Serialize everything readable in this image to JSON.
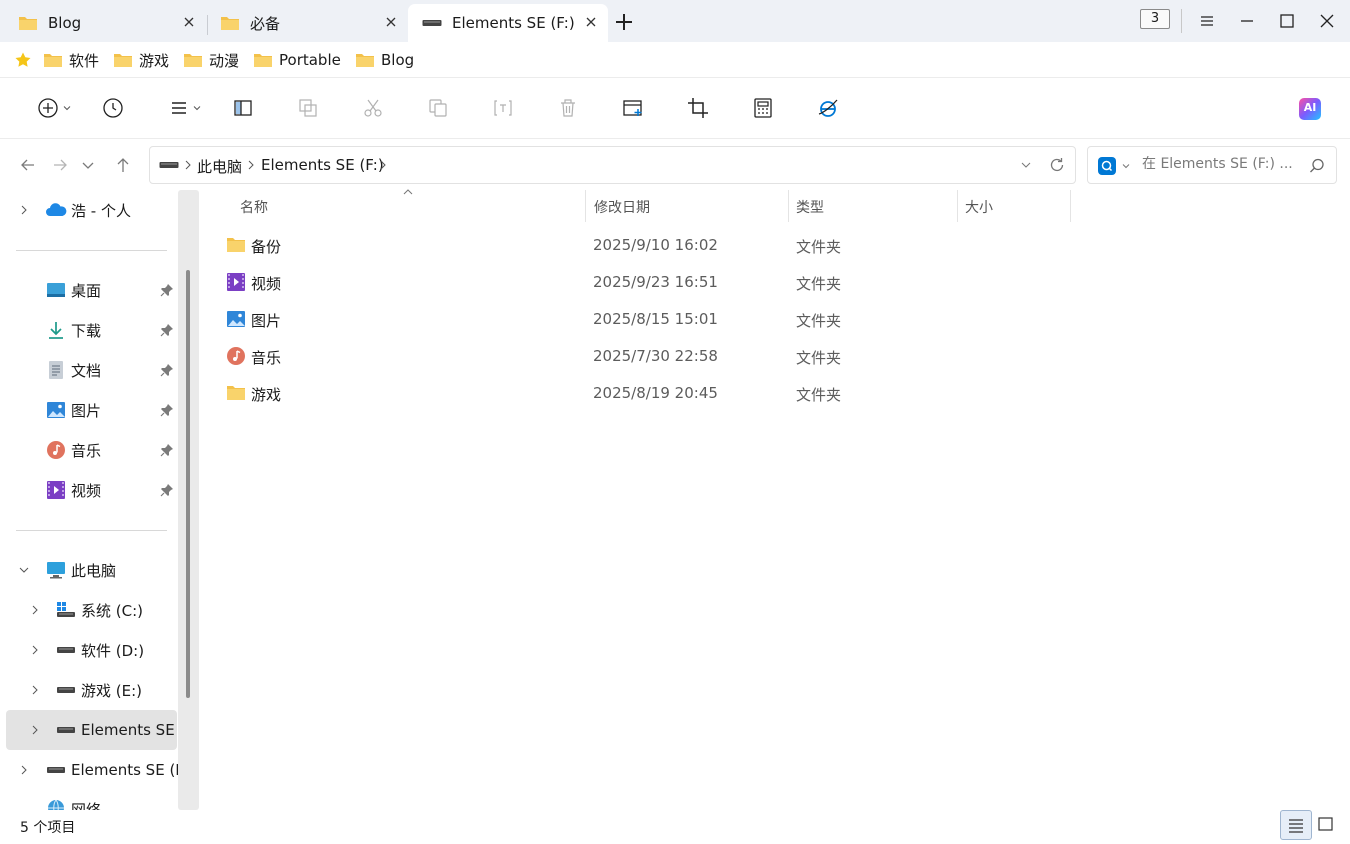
{
  "tabs": [
    {
      "label": "Blog",
      "icon": "folder-icon"
    },
    {
      "label": "必备",
      "icon": "folder-icon"
    },
    {
      "label": "Elements SE (F:)",
      "icon": "drive-icon",
      "active": true
    }
  ],
  "tab_count": "3",
  "favorites": [
    {
      "label": "软件"
    },
    {
      "label": "游戏"
    },
    {
      "label": "动漫"
    },
    {
      "label": "Portable"
    },
    {
      "label": "Blog"
    }
  ],
  "address": {
    "crumbs": [
      "此电脑",
      "Elements SE (F:)"
    ]
  },
  "search": {
    "placeholder": "在 Elements SE (F:) ..."
  },
  "sidebar": {
    "cloud": {
      "label": "浩 - 个人"
    },
    "quick_access": [
      {
        "label": "桌面",
        "icon": "desktop-icon"
      },
      {
        "label": "下载",
        "icon": "download-icon"
      },
      {
        "label": "文档",
        "icon": "document-icon"
      },
      {
        "label": "图片",
        "icon": "pictures-icon"
      },
      {
        "label": "音乐",
        "icon": "music-icon"
      },
      {
        "label": "视频",
        "icon": "videos-icon"
      }
    ],
    "this_pc": {
      "label": "此电脑"
    },
    "drives": [
      {
        "label": "系统 (C:)",
        "icon": "windows-drive-icon"
      },
      {
        "label": "软件 (D:)",
        "icon": "drive-icon"
      },
      {
        "label": "游戏 (E:)",
        "icon": "drive-icon"
      },
      {
        "label": "Elements SE (",
        "icon": "drive-icon",
        "selected": true
      }
    ],
    "external": {
      "label": "Elements SE (F:"
    },
    "network": {
      "label": "网络"
    }
  },
  "columns": {
    "name": "名称",
    "modified": "修改日期",
    "type": "类型",
    "size": "大小"
  },
  "files": [
    {
      "name": "备份",
      "modified": "2025/9/10 16:02",
      "type": "文件夹",
      "icon": "folder-icon"
    },
    {
      "name": "视频",
      "modified": "2025/9/23 16:51",
      "type": "文件夹",
      "icon": "videos-icon"
    },
    {
      "name": "图片",
      "modified": "2025/8/15 15:01",
      "type": "文件夹",
      "icon": "pictures-icon"
    },
    {
      "name": "音乐",
      "modified": "2025/7/30 22:58",
      "type": "文件夹",
      "icon": "music-icon"
    },
    {
      "name": "游戏",
      "modified": "2025/8/19 20:45",
      "type": "文件夹",
      "icon": "folder-icon"
    }
  ],
  "status": {
    "item_count": "5 个项目"
  },
  "ai_badge": "AI",
  "colors": {
    "folder": "#f3c14a",
    "accent": "#0078d4",
    "selected_bg": "#e3e3e3",
    "tabbar_bg": "#eef1f6"
  }
}
